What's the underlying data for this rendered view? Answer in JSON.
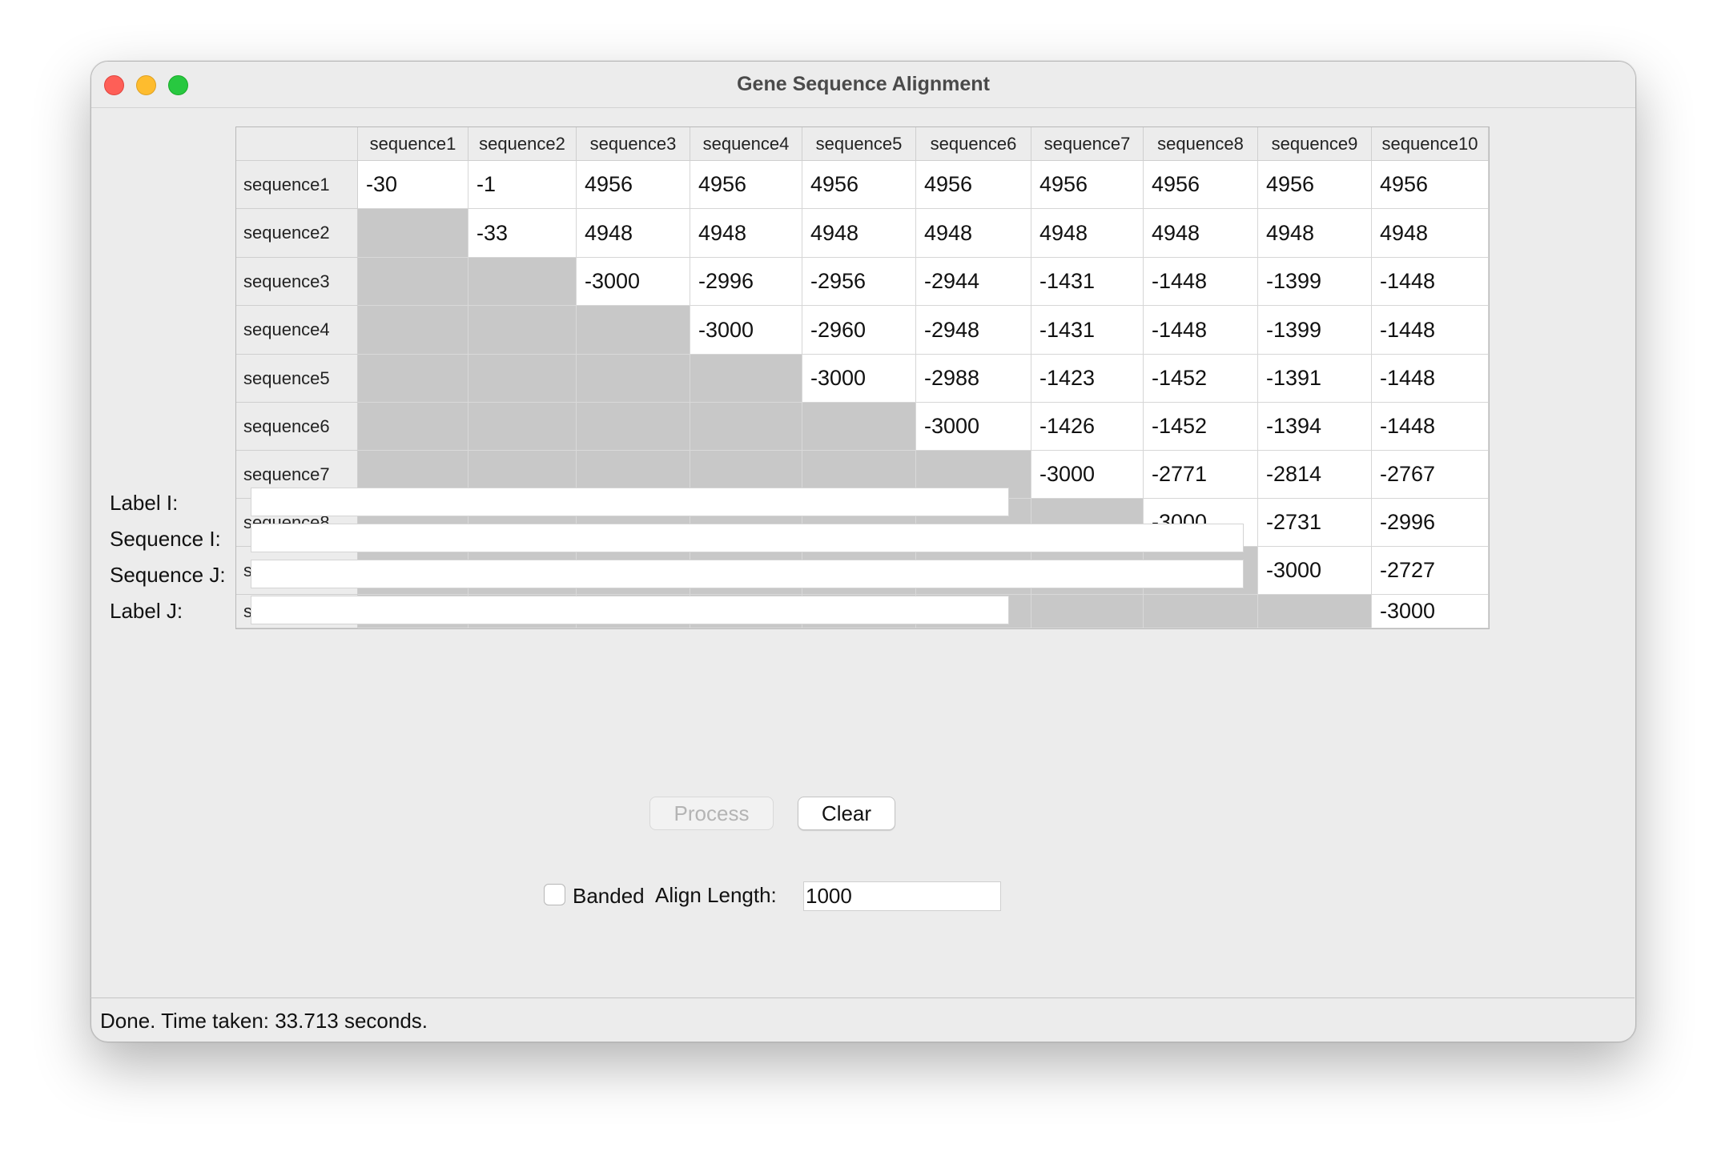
{
  "window": {
    "title": "Gene Sequence Alignment"
  },
  "matrix": {
    "columns": [
      "sequence1",
      "sequence2",
      "sequence3",
      "sequence4",
      "sequence5",
      "sequence6",
      "sequence7",
      "sequence8",
      "sequence9",
      "sequence10"
    ],
    "rows": [
      {
        "label": "sequence1",
        "cells": [
          "-30",
          "-1",
          "4956",
          "4956",
          "4956",
          "4956",
          "4956",
          "4956",
          "4956",
          "4956"
        ]
      },
      {
        "label": "sequence2",
        "cells": [
          "",
          "-33",
          "4948",
          "4948",
          "4948",
          "4948",
          "4948",
          "4948",
          "4948",
          "4948"
        ]
      },
      {
        "label": "sequence3",
        "cells": [
          "",
          "",
          "-3000",
          "-2996",
          "-2956",
          "-2944",
          "-1431",
          "-1448",
          "-1399",
          "-1448"
        ]
      },
      {
        "label": "sequence4",
        "cells": [
          "",
          "",
          "",
          "-3000",
          "-2960",
          "-2948",
          "-1431",
          "-1448",
          "-1399",
          "-1448"
        ]
      },
      {
        "label": "sequence5",
        "cells": [
          "",
          "",
          "",
          "",
          "-3000",
          "-2988",
          "-1423",
          "-1452",
          "-1391",
          "-1448"
        ]
      },
      {
        "label": "sequence6",
        "cells": [
          "",
          "",
          "",
          "",
          "",
          "-3000",
          "-1426",
          "-1452",
          "-1394",
          "-1448"
        ]
      },
      {
        "label": "sequence7",
        "cells": [
          "",
          "",
          "",
          "",
          "",
          "",
          "-3000",
          "-2771",
          "-2814",
          "-2767"
        ]
      },
      {
        "label": "sequence8",
        "cells": [
          "",
          "",
          "",
          "",
          "",
          "",
          "",
          "-3000",
          "-2731",
          "-2996"
        ]
      },
      {
        "label": "sequence9",
        "cells": [
          "",
          "",
          "",
          "",
          "",
          "",
          "",
          "",
          "-3000",
          "-2727"
        ]
      },
      {
        "label": "sequence10",
        "cells": [
          "",
          "",
          "",
          "",
          "",
          "",
          "",
          "",
          "",
          "-3000"
        ]
      }
    ]
  },
  "form": {
    "label_i": {
      "label": "Label I:",
      "value": ""
    },
    "sequence_i": {
      "label": "Sequence I:",
      "value": ""
    },
    "sequence_j": {
      "label": "Sequence J:",
      "value": ""
    },
    "label_j": {
      "label": "Label J:",
      "value": ""
    }
  },
  "buttons": {
    "process": "Process",
    "clear": "Clear",
    "process_enabled": false
  },
  "options": {
    "banded_label": "Banded",
    "banded_checked": false,
    "align_length_label": "Align Length:",
    "align_length_value": "1000"
  },
  "status": {
    "text": "Done.  Time taken: 33.713 seconds."
  }
}
